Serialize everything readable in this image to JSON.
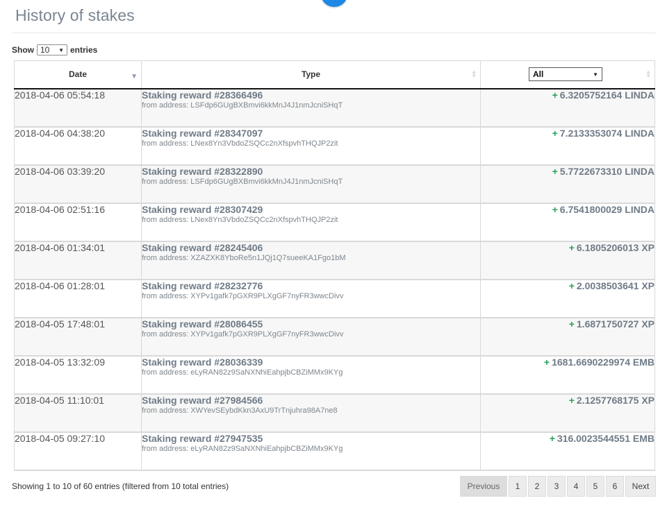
{
  "page": {
    "title": "History of stakes"
  },
  "length_control": {
    "show_label": "Show",
    "selected": "10",
    "entries_label": "entries"
  },
  "table": {
    "headers": {
      "date": "Date",
      "type": "Type",
      "filter_selected": "All"
    },
    "from_prefix": "from address:",
    "rows": [
      {
        "date": "2018-04-06 05:54:18",
        "title": "Staking reward #28366496",
        "from": "from address: LSFdp6GUgBXBmvi6kkMnJ4J1nmJcniSHqT",
        "amount": "6.3205752164 LINDA"
      },
      {
        "date": "2018-04-06 04:38:20",
        "title": "Staking reward #28347097",
        "from": "from address: LNex8Yn3VbdoZSQCc2nXfspvhTHQJP2zit",
        "amount": "7.2133353074 LINDA"
      },
      {
        "date": "2018-04-06 03:39:20",
        "title": "Staking reward #28322890",
        "from": "from address: LSFdp6GUgBXBmvi6kkMnJ4J1nmJcniSHqT",
        "amount": "5.7722673310 LINDA"
      },
      {
        "date": "2018-04-06 02:51:16",
        "title": "Staking reward #28307429",
        "from": "from address: LNex8Yn3VbdoZSQCc2nXfspvhTHQJP2zit",
        "amount": "6.7541800029 LINDA"
      },
      {
        "date": "2018-04-06 01:34:01",
        "title": "Staking reward #28245406",
        "from": "from address: XZAZXK8YboRe5n1JQj1Q7sueeKA1Fgo1bM",
        "amount": "6.1805206013 XP"
      },
      {
        "date": "2018-04-06 01:28:01",
        "title": "Staking reward #28232776",
        "from": "from address: XYPv1gafk7pGXR9PLXgGF7nyFR3wwcDivv",
        "amount": "2.0038503641 XP"
      },
      {
        "date": "2018-04-05 17:48:01",
        "title": "Staking reward #28086455",
        "from": "from address: XYPv1gafk7pGXR9PLXgGF7nyFR3wwcDivv",
        "amount": "1.6871750727 XP"
      },
      {
        "date": "2018-04-05 13:32:09",
        "title": "Staking reward #28036339",
        "from": "from address: eLyRAN82z9SaNXNhiEahpjbCBZiMMx9KYg",
        "amount": "1681.6690229974 EMB"
      },
      {
        "date": "2018-04-05 11:10:01",
        "title": "Staking reward #27984566",
        "from": "from address: XWYevSEybdKkn3AxU9TrTnjuhra98A7ne8",
        "amount": "2.1257768175 XP"
      },
      {
        "date": "2018-04-05 09:27:10",
        "title": "Staking reward #27947535",
        "from": "from address: eLyRAN82z9SaNXNhiEahpjbCBZiMMx9KYg",
        "amount": "316.0023544551 EMB"
      }
    ],
    "amount_sign": "+"
  },
  "footer": {
    "info": "Showing 1 to 10 of 60 entries (filtered from 10 total entries)",
    "pagination": {
      "previous": "Previous",
      "pages": [
        "1",
        "2",
        "3",
        "4",
        "5",
        "6"
      ],
      "next": "Next"
    }
  },
  "colors": {
    "accent_circle": "#1e88e5",
    "positive_sign": "#28a05a"
  }
}
